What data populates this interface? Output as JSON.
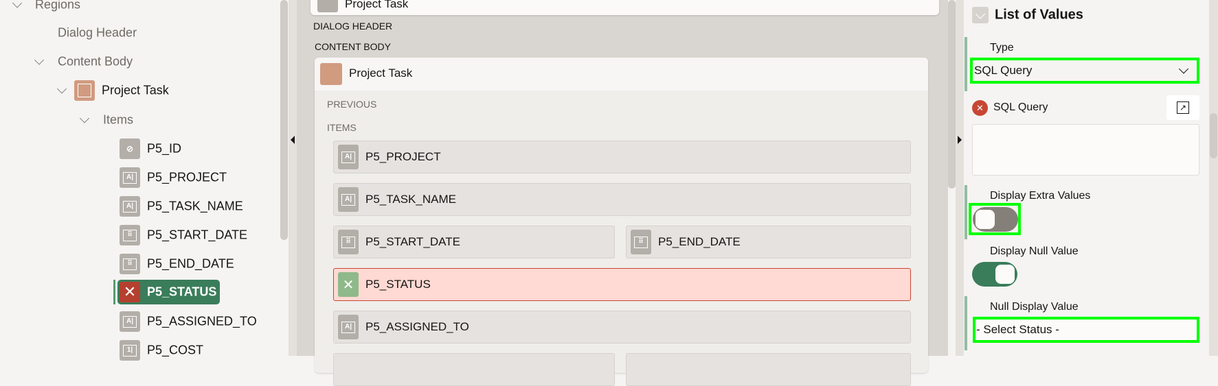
{
  "tree": {
    "regions": "Regions",
    "dialog_header": "Dialog Header",
    "content_body": "Content Body",
    "project_task": "Project Task",
    "items_label": "Items",
    "items": [
      {
        "label": "P5_ID",
        "icon": "hidden-item-icon"
      },
      {
        "label": "P5_PROJECT",
        "icon": "text-field-icon"
      },
      {
        "label": "P5_TASK_NAME",
        "icon": "text-field-icon"
      },
      {
        "label": "P5_START_DATE",
        "icon": "date-picker-icon"
      },
      {
        "label": "P5_END_DATE",
        "icon": "date-picker-icon"
      },
      {
        "label": "P5_STATUS",
        "icon": "error-icon",
        "selected": true
      },
      {
        "label": "P5_ASSIGNED_TO",
        "icon": "text-field-icon"
      },
      {
        "label": "P5_COST",
        "icon": "number-field-icon"
      }
    ]
  },
  "layout": {
    "top_card_title": "Project Task",
    "dialog_header": "DIALOG HEADER",
    "content_body": "CONTENT BODY",
    "region_title": "Project Task",
    "previous": "PREVIOUS",
    "items": "ITEMS",
    "item_labels": {
      "project": "P5_PROJECT",
      "task_name": "P5_TASK_NAME",
      "start_date": "P5_START_DATE",
      "end_date": "P5_END_DATE",
      "status": "P5_STATUS",
      "assigned_to": "P5_ASSIGNED_TO"
    }
  },
  "properties": {
    "section_title": "List of Values",
    "type_label": "Type",
    "type_value": "SQL Query",
    "sql_query_label": "SQL Query",
    "sql_query_value": "",
    "display_extra_values_label": "Display Extra Values",
    "display_extra_values": false,
    "display_null_value_label": "Display Null Value",
    "display_null_value": true,
    "null_display_value_label": "Null Display Value",
    "null_display_value": "- Select Status -"
  },
  "colors": {
    "accent_green": "#3a7d5a",
    "error_red": "#c74634",
    "highlight": "#00ff00"
  }
}
